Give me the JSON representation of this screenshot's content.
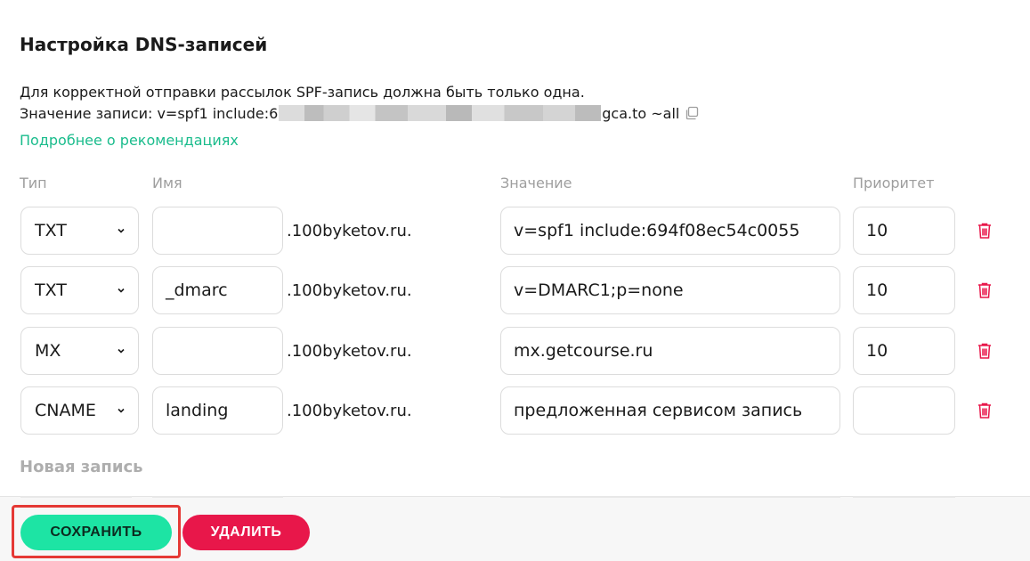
{
  "title": "Настройка DNS-записей",
  "description": {
    "line1": "Для корректной отправки рассылок SPF-запись должна быть только одна.",
    "line2_prefix": "Значение записи: v=spf1 include:6",
    "line2_suffix": "gca.to ~all"
  },
  "link": "Подробнее о рекомендациях",
  "columns": {
    "type": "Тип",
    "name": "Имя",
    "value": "Значение",
    "priority": "Приоритет"
  },
  "records": [
    {
      "type": "TXT",
      "name": "",
      "domain": ".100byketov.ru.",
      "value": "v=spf1 include:694f08ec54c0055",
      "priority": "10"
    },
    {
      "type": "TXT",
      "name": "_dmarc",
      "domain": ".100byketov.ru.",
      "value": "v=DMARC1;p=none",
      "priority": "10"
    },
    {
      "type": "MX",
      "name": "",
      "domain": ".100byketov.ru.",
      "value": "mx.getcourse.ru",
      "priority": "10"
    },
    {
      "type": "CNAME",
      "name": "landing",
      "domain": ".100byketov.ru.",
      "value": "предложенная сервисом запись",
      "priority": ""
    }
  ],
  "new_record_label": "Новая запись",
  "buttons": {
    "save": "СОХРАНИТЬ",
    "delete": "УДАЛИТЬ"
  },
  "colors": {
    "accent": "#1de4a4",
    "link": "#1abc8c",
    "danger": "#e8174a",
    "highlight": "#e53935"
  }
}
